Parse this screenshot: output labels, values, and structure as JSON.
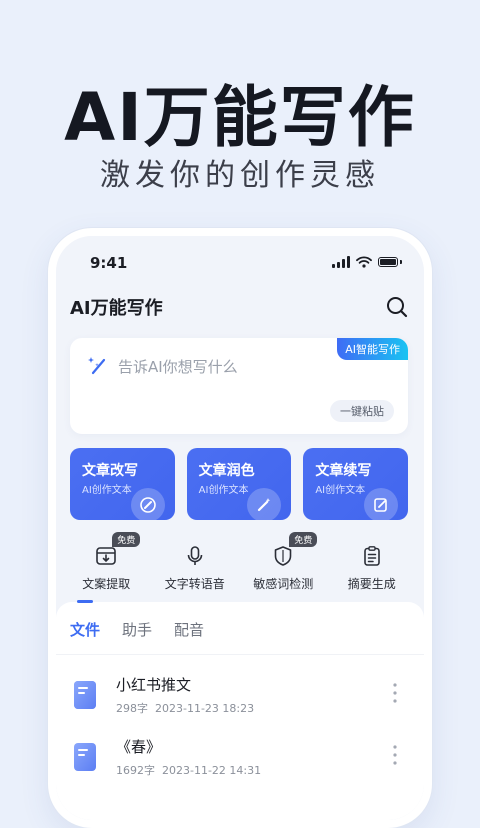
{
  "hero": {
    "title": "AI万能写作",
    "subtitle": "激发你的创作灵感"
  },
  "status_bar": {
    "time": "9:41",
    "icons": [
      "signal-icon",
      "wifi-icon",
      "battery-icon"
    ]
  },
  "header": {
    "title": "AI万能写作",
    "search_icon": "search-icon"
  },
  "prompt": {
    "badge": "AI智能写作",
    "icon": "sparkle-pen-icon",
    "placeholder": "告诉AI你想写什么",
    "paste_label": "一键粘贴"
  },
  "features": [
    {
      "title": "文章改写",
      "desc": "AI创作文本",
      "icon": "rewrite-icon"
    },
    {
      "title": "文章润色",
      "desc": "AI创作文本",
      "icon": "magic-wand-icon"
    },
    {
      "title": "文章续写",
      "desc": "AI创作文本",
      "icon": "continue-edit-icon"
    }
  ],
  "tools": [
    {
      "label": "文案提取",
      "badge": "免费",
      "icon": "extract-icon"
    },
    {
      "label": "文字转语音",
      "badge": "",
      "icon": "microphone-icon"
    },
    {
      "label": "敏感词检测",
      "badge": "免费",
      "icon": "shield-icon"
    },
    {
      "label": "摘要生成",
      "badge": "",
      "icon": "clipboard-icon"
    }
  ],
  "tabs": [
    {
      "label": "文件",
      "active": true
    },
    {
      "label": "助手",
      "active": false
    },
    {
      "label": "配音",
      "active": false
    }
  ],
  "files": [
    {
      "name": "小红书推文",
      "words": "298字",
      "datetime": "2023-11-23 18:23"
    },
    {
      "name": "《春》",
      "words": "1692字",
      "datetime": "2023-11-22 14:31"
    }
  ],
  "colors": {
    "accent": "#3d6cf2",
    "card": "#4b6ff2",
    "background": "#eaf0fb"
  }
}
